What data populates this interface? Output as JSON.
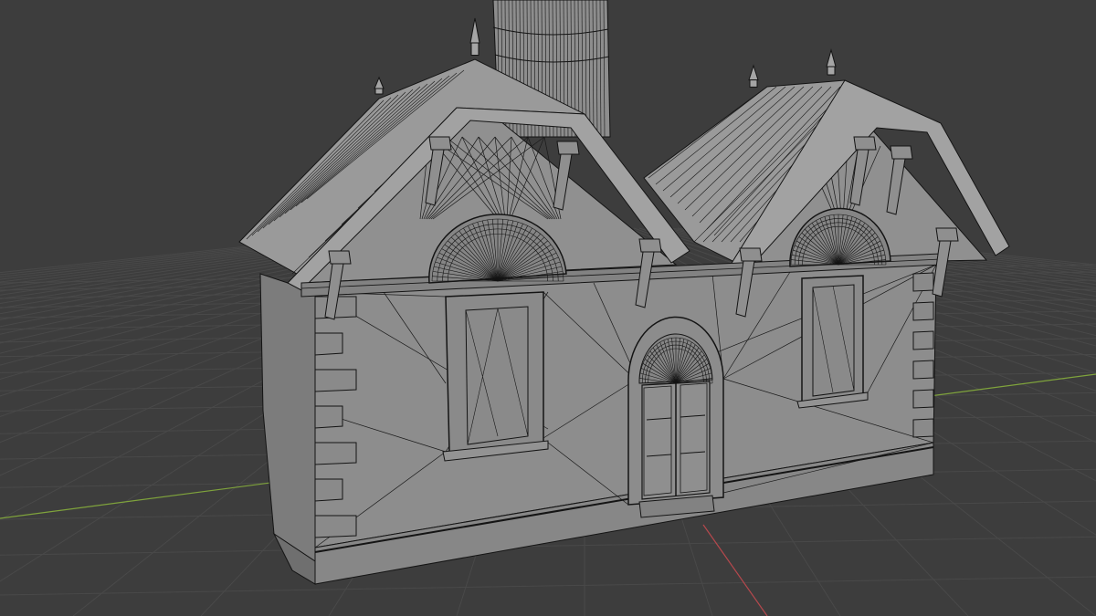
{
  "viewport": {
    "mode": "wireframe",
    "background_color": "#3d3d3d",
    "grid_color": "#494949",
    "axis_x_color": "#b5484d",
    "axis_y_color": "#7fa33c"
  },
  "model": {
    "fill_color": "#8b8b8b",
    "fill_dark": "#777777",
    "roof_color": "#9a9a9a",
    "wire_color": "#141414"
  }
}
